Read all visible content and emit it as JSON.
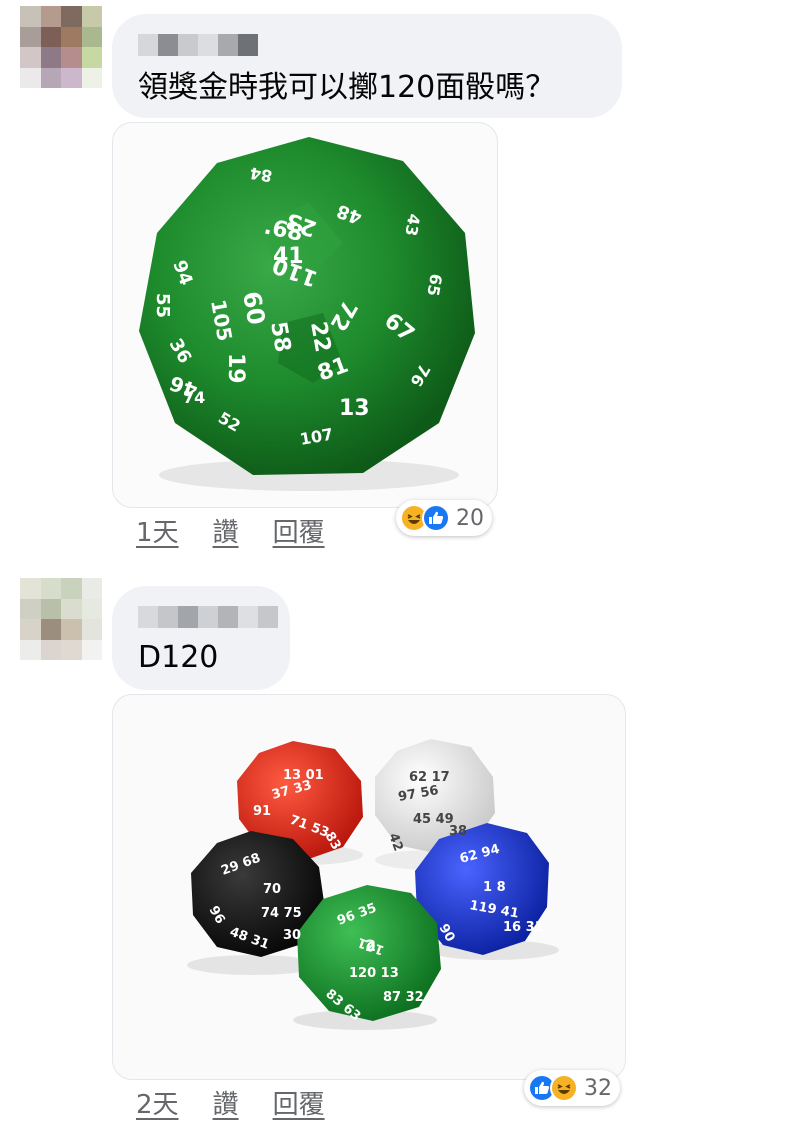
{
  "comments": [
    {
      "text": "領獎金時我可以擲120面骰嗎？",
      "time": "1天",
      "like_label": "讚",
      "reply_label": "回覆",
      "reaction_count": "20",
      "reaction_icons": [
        "haha-icon",
        "like-icon"
      ]
    },
    {
      "text": "D120",
      "time": "2天",
      "like_label": "讚",
      "reply_label": "回覆",
      "reaction_count": "32",
      "reaction_icons": [
        "like-icon",
        "haha-icon"
      ]
    }
  ],
  "colors": {
    "bubble": "#f0f2f5",
    "secondary_text": "#65676b",
    "like_blue": "#1877f2",
    "haha_yellow": "#f7b125",
    "die_green": "#1f8a2e",
    "die_red": "#e8261c",
    "die_white": "#eeeeee",
    "die_black": "#111111",
    "die_blue": "#1a33d6"
  }
}
